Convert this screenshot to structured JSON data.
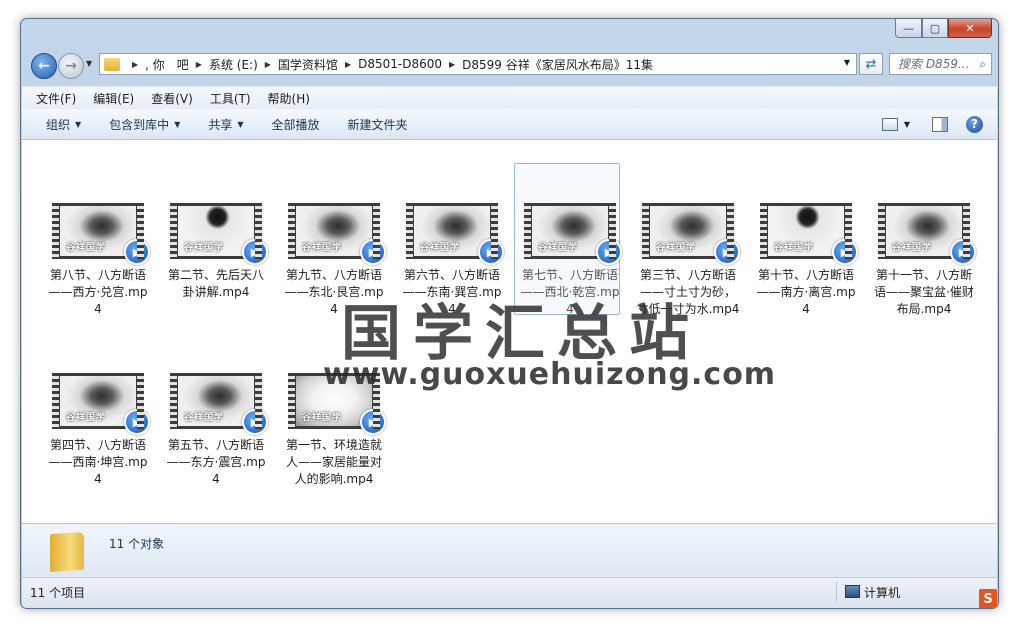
{
  "window": {
    "caption_buttons": {
      "minimize": "—",
      "maximize": "▢",
      "close": "✕"
    }
  },
  "address": {
    "crumbs": [
      ", 你　吧",
      "系统 (E:)",
      "国学资料馆",
      "D8501-D8600",
      "D8599 谷祥《家居风水布局》11集"
    ],
    "search_placeholder": "搜索 D859..."
  },
  "menu": [
    "文件(F)",
    "编辑(E)",
    "查看(V)",
    "工具(T)",
    "帮助(H)"
  ],
  "toolbar": {
    "items": [
      {
        "label": "组织",
        "dropdown": true
      },
      {
        "label": "包含到库中",
        "dropdown": true
      },
      {
        "label": "共享",
        "dropdown": true
      },
      {
        "label": "全部播放",
        "dropdown": false
      },
      {
        "label": "新建文件夹",
        "dropdown": false
      }
    ]
  },
  "files": [
    {
      "name": "第八节、八方断语——西方·兑宫.mp4",
      "thumb": "smoke",
      "selected": false
    },
    {
      "name": "第二节、先后天八卦讲解.mp4",
      "thumb": "drop",
      "selected": false
    },
    {
      "name": "第九节、八方断语——东北·艮宫.mp4",
      "thumb": "smoke",
      "selected": false
    },
    {
      "name": "第六节、八方断语——东南·巽宫.mp4",
      "thumb": "smoke",
      "selected": false
    },
    {
      "name": "第七节、八方断语——西北·乾宫.mp4",
      "thumb": "smoke",
      "selected": true
    },
    {
      "name": "第三节、八方断语——寸土寸为砂，寸低一寸为水.mp4",
      "thumb": "smoke",
      "selected": false
    },
    {
      "name": "第十节、八方断语——南方·离宫.mp4",
      "thumb": "drop",
      "selected": false
    },
    {
      "name": "第十一节、八方断语——聚宝盆·催财布局.mp4",
      "thumb": "smoke",
      "selected": false
    },
    {
      "name": "第四节、八方断语——西南·坤宫.mp4",
      "thumb": "smoke",
      "selected": false
    },
    {
      "name": "第五节、八方断语——东方·震宫.mp4",
      "thumb": "smoke",
      "selected": false
    },
    {
      "name": "第一节、环境造就人——家居能量对人的影响.mp4",
      "thumb": "ink",
      "selected": false
    }
  ],
  "thumb_watermark": "谷祥国学",
  "overlay": {
    "cn": "国学汇总站",
    "url": "www.guoxuehuizong.com"
  },
  "details": {
    "count_text": "11 个对象"
  },
  "status": {
    "left": "11 个项目",
    "right": "计算机"
  },
  "corner_logo": "S",
  "colors": {
    "accent": "#2460b5",
    "play_badge": "#1354b8",
    "close_red": "#c7452b"
  }
}
